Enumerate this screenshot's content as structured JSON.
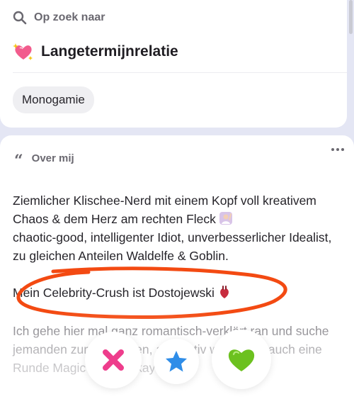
{
  "looking_for": {
    "heading": "Op zoek naar",
    "heading_icon": "search-icon",
    "goal_emoji": "heart-sparkle-icon",
    "goal": "Langetermijnrelatie",
    "chips": [
      "Monogamie"
    ]
  },
  "about": {
    "heading": "Over mij",
    "heading_icon": "quote-icon",
    "menu_icon": "more-dots-icon",
    "paragraph1": "Ziemlicher Klischee-Nerd mit einem Kopf voll kreativem Chaos & dem Herz am rechten Fleck",
    "paragraph1_tail": "chaotic-good, intelligenter Idiot, unverbesserlicher Idealist, zu gleichen Anteilen Waldelfe & Goblin.",
    "paragraph2": "Mein Celebrity-Crush ist Dostojewski",
    "paragraph3": "Ich gehe hier mal ganz romantisch-verklärt ran und suche jemanden zum Verlieben, alternativ wäre aber auch eine Runde Magic Runde okay"
  },
  "actions": {
    "pass_icon": "pass-x-icon",
    "super_icon": "superlike-star-icon",
    "like_icon": "like-heart-icon"
  },
  "colors": {
    "background": "#e4e6f4",
    "card": "#ffffff",
    "pass": "#ee3d8c",
    "super": "#2f8de8",
    "like": "#6cc11f",
    "annotation": "#f34a12"
  }
}
